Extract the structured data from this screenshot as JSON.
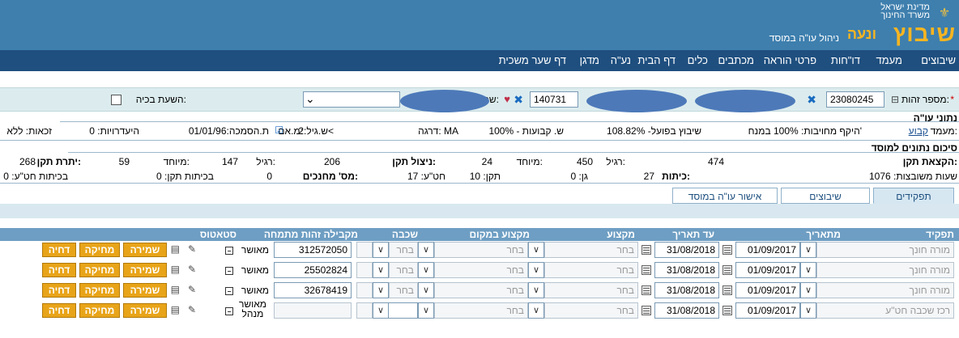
{
  "header": {
    "ministry_line1": "מדינת ישראל",
    "ministry_line2": "משרד החינוך",
    "logo": "שיבוץ",
    "logo2": "ונעה",
    "subtitle": "ניהול עו\"ה במוסד"
  },
  "nav": [
    "שיבוצים",
    "מעמד",
    "דו\"חות",
    "פרטי הוראה",
    "מכתבים",
    "כלים",
    "דף הבית",
    "נע\"ה",
    "מדגן",
    "דף שער משכית"
  ],
  "id_row": {
    "id_label": "מספר זהות:",
    "id_value": "23080245",
    "second_value": "140731",
    "name_label": "שם:",
    "pregnancy_label": "השעת בכיה:"
  },
  "teacher": {
    "section_title": "נתוני עו\"ה",
    "status_label": "מעמד:",
    "status_value": "קבוע",
    "mandatory_scope": "היקף מחויבות: 100% במנח'",
    "actual": "שיבוץ בפועל- 108.82%",
    "tenure": "ש. קבועות - 100%",
    "rank": "דרגה: MA",
    "age": "ש.גיל:2<",
    "certified": "מ.אם:",
    "cert_date": "ת.הסמכה:01/01/96",
    "absences": "היעדרויות: 0",
    "rights": "זכאות: ללא"
  },
  "summary": {
    "section_title": "סיכום נתונים למוסד",
    "alloc_label": "הקצאת תקן:",
    "alloc_value": "474",
    "regular_label": "רגיל:",
    "regular_value": "450",
    "special_label": "מיוחד:",
    "special_value": "24",
    "usage_label": "ניצול תקן:",
    "usage_value": "206",
    "usage_regular_label": "רגיל:",
    "usage_regular_value": "147",
    "usage_special_label": "מיוחד:",
    "usage_special_value": "59",
    "surplus_label": "יתרת תקן:",
    "surplus_value": "268",
    "hours": "שעות משובצות: 1076",
    "classes_label": "כיתות:",
    "classes_value": "27",
    "kg": "גן: 0",
    "std": "תקן: 10",
    "hativa": "חט\"ע: 17",
    "educators_label": "מס' מחנכים:",
    "educators_value": "0",
    "std_classes": "בכיתות תקן: 0",
    "hativa_classes": "בכיתות חט\"ע: 0"
  },
  "tabs": [
    "תפקידים",
    "שיבוצים",
    "אישור עו\"ה במוסד"
  ],
  "table": {
    "headers": [
      "תפקיד",
      "מתאריך",
      "עד תאריך",
      "מקצוע",
      "מקצוע במקום",
      "שכבה",
      "מקבילה זהות מתמחה",
      "סטאטוס"
    ],
    "rows": [
      {
        "role": "מורה חונך",
        "from": "01/09/2017",
        "to": "31/08/2018",
        "subject": "בחר",
        "subject2": "בחר",
        "layer": "בחר",
        "id": "312572050",
        "status": "מאושר"
      },
      {
        "role": "מורה חונך",
        "from": "01/09/2017",
        "to": "31/08/2018",
        "subject": "בחר",
        "subject2": "בחר",
        "layer": "בחר",
        "id": "25502824",
        "status": "מאושר"
      },
      {
        "role": "מורה חונך",
        "from": "01/09/2017",
        "to": "31/08/2018",
        "subject": "בחר",
        "subject2": "בחר",
        "layer": "בחר",
        "id": "32678419",
        "status": "מאושר"
      },
      {
        "role": "רכז שכבה חט\"ע",
        "from": "01/09/2017",
        "to": "31/08/2018",
        "subject": "בחר",
        "subject2": "בחר",
        "layer": "",
        "id": "",
        "status": "מאושר מנהל"
      }
    ],
    "buttons": {
      "save": "שמירה",
      "delete": "מחיקה",
      "reject": "דחיה"
    }
  }
}
